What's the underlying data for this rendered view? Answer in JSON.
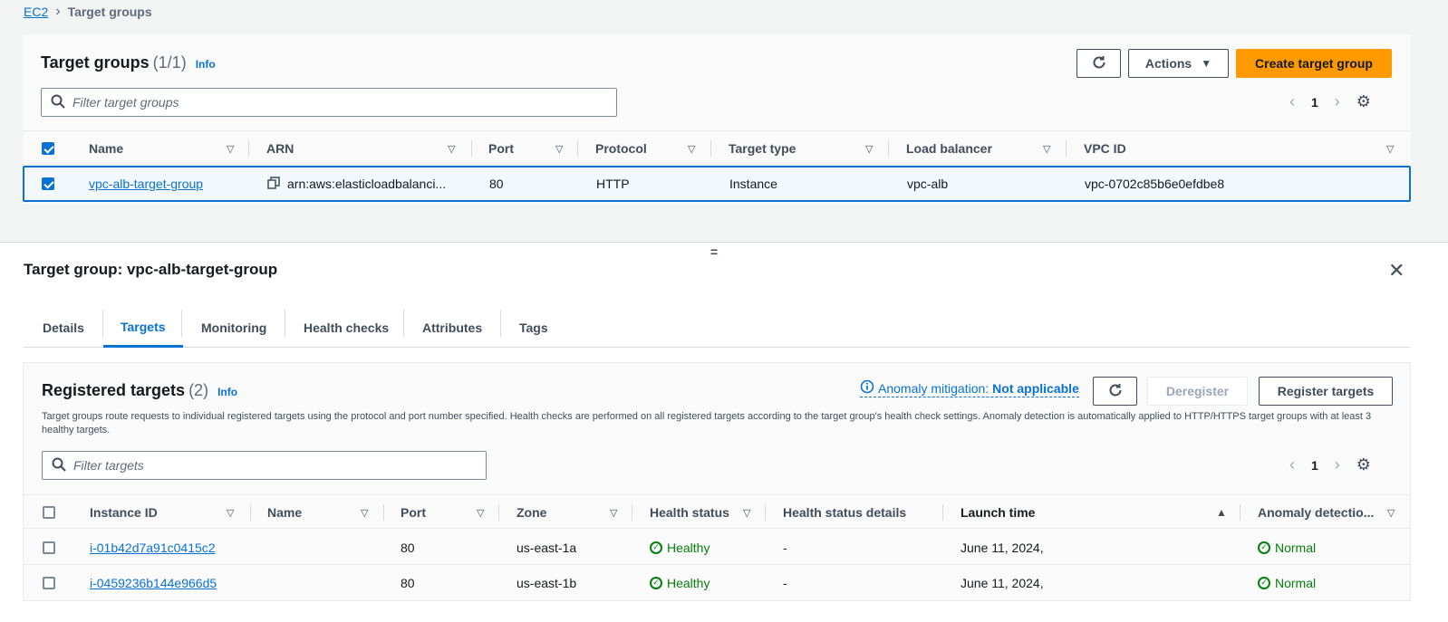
{
  "breadcrumb": {
    "root": "EC2",
    "current": "Target groups"
  },
  "target_groups": {
    "title": "Target groups",
    "count": "(1/1)",
    "info": "Info",
    "refresh_icon": "refresh-icon",
    "actions_label": "Actions",
    "create_label": "Create target group",
    "search_placeholder": "Filter target groups",
    "page": "1",
    "columns": [
      "Name",
      "ARN",
      "Port",
      "Protocol",
      "Target type",
      "Load balancer",
      "VPC ID"
    ],
    "rows": [
      {
        "name": "vpc-alb-target-group",
        "arn": "arn:aws:elasticloadbalanci...",
        "port": "80",
        "protocol": "HTTP",
        "target_type": "Instance",
        "load_balancer": "vpc-alb",
        "vpc_id": "vpc-0702c85b6e0efdbe8"
      }
    ]
  },
  "resize_handle": "=",
  "details": {
    "title": "Target group: vpc-alb-target-group",
    "close": "✕",
    "tabs": [
      "Details",
      "Targets",
      "Monitoring",
      "Health checks",
      "Attributes",
      "Tags"
    ],
    "active_tab": "Targets"
  },
  "registered": {
    "title": "Registered targets",
    "count": "(2)",
    "info": "Info",
    "anomaly_label": "Anomaly mitigation:",
    "anomaly_value": "Not applicable",
    "deregister_label": "Deregister",
    "register_label": "Register targets",
    "description": "Target groups route requests to individual registered targets using the protocol and port number specified. Health checks are performed on all registered targets according to the target group's health check settings. Anomaly detection is automatically applied to HTTP/HTTPS target groups with at least 3 healthy targets.",
    "search_placeholder": "Filter targets",
    "page": "1",
    "columns": [
      "Instance ID",
      "Name",
      "Port",
      "Zone",
      "Health status",
      "Health status details",
      "Launch time",
      "Anomaly detectio..."
    ],
    "rows": [
      {
        "instance_id": "i-01b42d7a91c0415c2",
        "name": "",
        "port": "80",
        "zone": "us-east-1a",
        "health": "Healthy",
        "health_details": "-",
        "launch_time": "June 11, 2024,",
        "anomaly": "Normal"
      },
      {
        "instance_id": "i-0459236b144e966d5",
        "name": "",
        "port": "80",
        "zone": "us-east-1b",
        "health": "Healthy",
        "health_details": "-",
        "launch_time": "June 11, 2024,",
        "anomaly": "Normal"
      }
    ]
  },
  "colors": {
    "accent": "#0972d3",
    "primary_button": "#ff9900",
    "success": "#037f0c"
  }
}
